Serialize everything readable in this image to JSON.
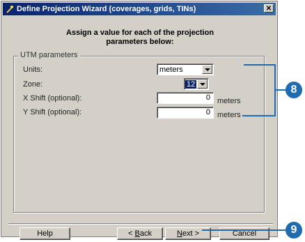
{
  "window": {
    "title": "Define Projection Wizard (coverages, grids, TINs)",
    "close_glyph": "✕"
  },
  "heading": {
    "line1": "Assign a value for each of the projection",
    "line2": "parameters below:"
  },
  "group": {
    "legend": "UTM parameters"
  },
  "params": {
    "units_label": "Units:",
    "units_value": "meters",
    "zone_label": "Zone:",
    "zone_value": "12",
    "xshift_label": "X Shift (optional):",
    "xshift_value": "0",
    "xshift_unit": "meters",
    "yshift_label": "Y Shift (optional):",
    "yshift_value": "0",
    "yshift_unit": "meters"
  },
  "buttons": {
    "help": "Help",
    "back": "< Back",
    "next": "Next >",
    "cancel": "Cancel"
  },
  "callouts": {
    "step8": "8",
    "step9": "9"
  },
  "colors": {
    "callout": "#1e6bb0",
    "titlebar": "#0a246a"
  },
  "icons": {
    "app": "wizard-wand-icon",
    "close": "close-icon",
    "dropdown": "chevron-down-icon"
  }
}
